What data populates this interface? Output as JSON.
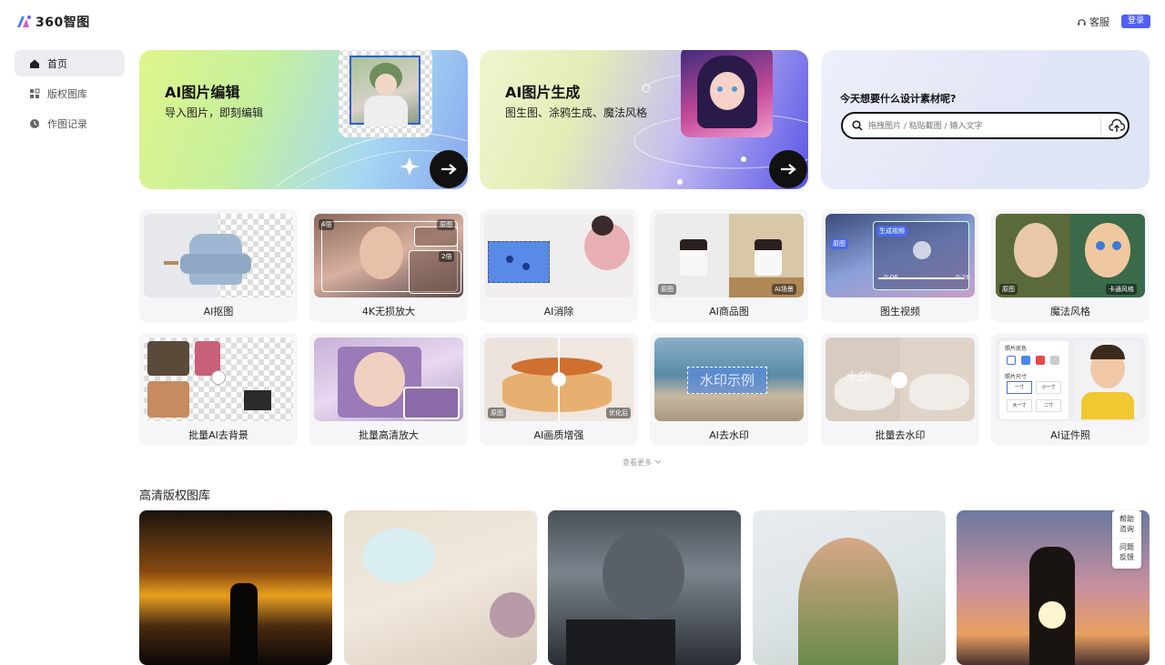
{
  "header": {
    "logo_text": "360智图",
    "support_label": "客服",
    "login_label": "登录"
  },
  "sidebar": {
    "items": [
      {
        "label": "首页",
        "icon": "home-icon",
        "active": true
      },
      {
        "label": "版权图库",
        "icon": "gallery-icon",
        "active": false
      },
      {
        "label": "作图记录",
        "icon": "history-icon",
        "active": false
      }
    ]
  },
  "banners": [
    {
      "title": "AI图片编辑",
      "subtitle": "导入图片，即刻编辑"
    },
    {
      "title": "AI图片生成",
      "subtitle": "图生图、涂鸦生成、魔法风格"
    }
  ],
  "search": {
    "title": "今天想要什么设计素材呢?",
    "placeholder": "拖拽图片 / 粘贴截图 / 输入文字"
  },
  "tools_row1": [
    {
      "label": "AI抠图"
    },
    {
      "label": "4K无损放大",
      "badge_a": "4倍",
      "badge_b": "原图",
      "badge_c": "2倍"
    },
    {
      "label": "AI消除"
    },
    {
      "label": "AI商品图",
      "badge_a": "原图",
      "badge_b": "AI场景"
    },
    {
      "label": "图生视频",
      "badge_a": "原图",
      "badge_b": "生成视频",
      "time_a": "0:06",
      "time_b": "0:26"
    },
    {
      "label": "魔法风格",
      "badge_a": "原图",
      "badge_b": "卡通风格"
    }
  ],
  "tools_row2": [
    {
      "label": "批量AI去背景"
    },
    {
      "label": "批量高清放大"
    },
    {
      "label": "AI画质增强",
      "badge_a": "原图",
      "badge_b": "优化后"
    },
    {
      "label": "AI去水印",
      "watermark": "水印示例"
    },
    {
      "label": "批量去水印",
      "watermark": "水印"
    },
    {
      "label": "AI证件照",
      "panel_a": "照片底色",
      "panel_b": "照片尺寸",
      "size_1": "一寸",
      "size_2": "小一寸",
      "size_3": "大一寸",
      "size_4": "二寸"
    }
  ],
  "more_label": "查看更多",
  "gallery_title": "高清版权图库",
  "help": {
    "line1": "帮助",
    "line2": "咨询",
    "line3": "问题",
    "line4": "反馈"
  },
  "colors": {
    "accent": "#4f5ef7",
    "sidebar_active": "#ececf1",
    "card_bg": "#f6f6f8"
  }
}
